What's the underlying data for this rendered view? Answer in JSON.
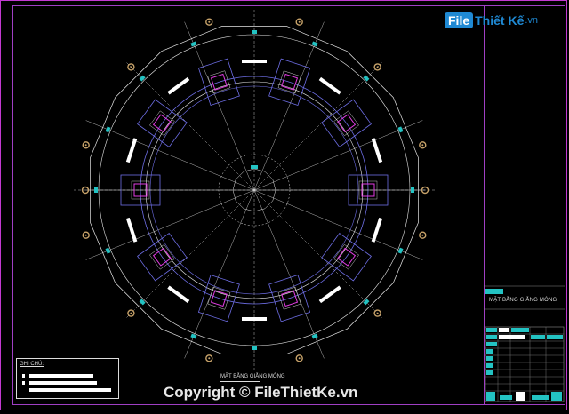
{
  "logo": {
    "box_text": "File",
    "text": "Thiết Kế",
    "tld": ".vn"
  },
  "title_block": {
    "drawing_title": "MẶT BẰNG GIẰNG MÓNG"
  },
  "notes": {
    "title": "GHI CHÚ:"
  },
  "plan": {
    "caption": "MẶT BẰNG GIẰNG MÓNG"
  },
  "watermark": {
    "text": "Copyright © FileThietKe.vn"
  },
  "colors": {
    "frame_outer": "#c23ad1",
    "frame_inner": "#9f3fc4",
    "footing": "#6e6ee6",
    "column": "#e23ce2",
    "cyan_marker": "#23c3c3",
    "line_white": "#e6e6e6",
    "bolt": "#c8a36a"
  }
}
